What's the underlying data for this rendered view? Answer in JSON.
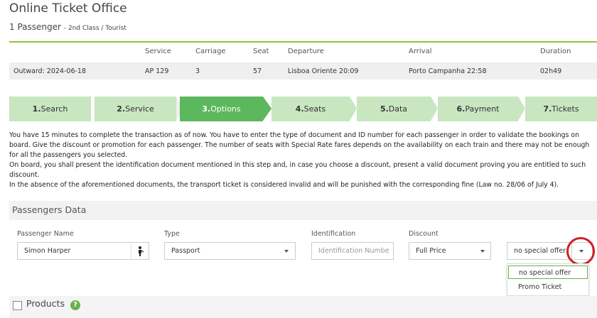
{
  "header": {
    "title": "Online Ticket Office",
    "passengers": "1 Passenger",
    "class_info": "- 2nd Class / Tourist"
  },
  "trip": {
    "columns": [
      "Service",
      "Carriage",
      "Seat",
      "Departure",
      "Arrival",
      "Duration"
    ],
    "row": {
      "label": "Outward: 2024-06-18",
      "service": "AP 129",
      "carriage": "3",
      "seat": "57",
      "departure": "Lisboa Oriente 20:09",
      "arrival": "Porto Campanha 22:58",
      "duration": "02h49"
    }
  },
  "steps": [
    {
      "num": "1.",
      "label": "Search",
      "state": "done"
    },
    {
      "num": "2.",
      "label": "Service",
      "state": "done"
    },
    {
      "num": "3.",
      "label": "Options",
      "state": "active"
    },
    {
      "num": "4.",
      "label": "Seats",
      "state": "todo"
    },
    {
      "num": "5.",
      "label": "Data",
      "state": "todo"
    },
    {
      "num": "6.",
      "label": "Payment",
      "state": "todo"
    },
    {
      "num": "7.",
      "label": "Tickets",
      "state": "todo"
    }
  ],
  "info": {
    "p1": "You have 15 minutes to complete the transaction as of now. You have to enter the type of document and ID number for each passenger in order to validate the bookings on board. Give the discount or promotion for each passenger. The number of seats with Special Rate fares depends on the availability on each train and there may not be enough for all the passengers you selected.",
    "p2": "On board, you shall present the identification document mentioned in this step and, in case you choose a discount, present a valid document proving you are entitled to such discount.",
    "p3": "In the absence of the aforementioned documents, the transport ticket is considered invalid and will be punished with the corresponding fine (Law no. 28/06 of July 4)."
  },
  "passengers_section": {
    "title": "Passengers Data",
    "name_label": "Passenger Name",
    "name_value": "Simon Harper",
    "type_label": "Type",
    "type_value": "Passport",
    "id_label": "Identification",
    "id_placeholder": "Identification Numbe",
    "discount_label": "Discount",
    "discount_value": "Full Price",
    "offer_value": "no special offer",
    "offer_options": [
      "no special offer",
      "Promo Ticket"
    ]
  },
  "products": {
    "label": "Products",
    "help": "?"
  },
  "colors": {
    "accent": "#5cb85c",
    "step_light": "#c8e6c0",
    "highlight_circle": "#cc1f26"
  }
}
